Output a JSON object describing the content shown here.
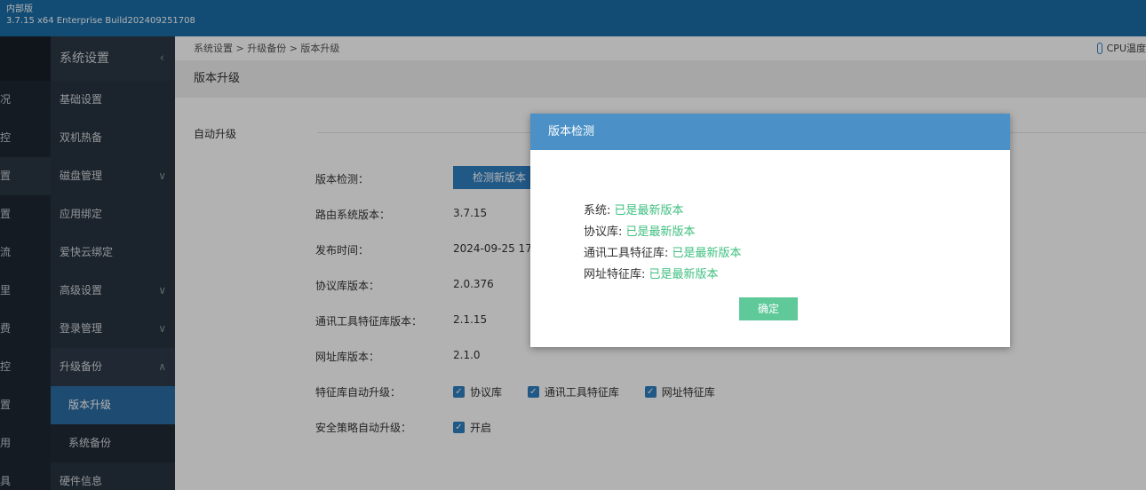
{
  "window": {
    "title_line1": "内部版",
    "title_line2": "3.7.15 x64 Enterprise Build202409251708"
  },
  "farleft": {
    "items": [
      "况",
      "控",
      "置",
      "置",
      "流",
      "里",
      "费",
      "控",
      "置",
      "用",
      "具"
    ]
  },
  "sidebar": {
    "title": "系统设置",
    "items": [
      {
        "label": "基础设置"
      },
      {
        "label": "双机热备"
      },
      {
        "label": "磁盘管理"
      },
      {
        "label": "应用绑定"
      },
      {
        "label": "爱快云绑定"
      },
      {
        "label": "高级设置"
      },
      {
        "label": "登录管理"
      },
      {
        "label": "升级备份"
      },
      {
        "label": "版本升级"
      },
      {
        "label": "系统备份"
      },
      {
        "label": "硬件信息"
      }
    ]
  },
  "breadcrumb": {
    "text": "系统设置 > 升级备份 > 版本升级"
  },
  "status": {
    "cpu_label": "CPU温度"
  },
  "page": {
    "title": "版本升级",
    "section": "自动升级"
  },
  "form": {
    "check_label": "版本检测：",
    "check_button": "检测新版本",
    "rows": [
      {
        "label": "路由系统版本：",
        "value": "3.7.15"
      },
      {
        "label": "发布时间：",
        "value": "2024-09-25 17:08"
      },
      {
        "label": "协议库版本：",
        "value": "2.0.376"
      },
      {
        "label": "通讯工具特征库版本：",
        "value": "2.1.15"
      },
      {
        "label": "网址库版本：",
        "value": "2.1.0"
      }
    ],
    "auto_upgrade_label": "特征库自动升级：",
    "auto_upgrade_options": [
      "协议库",
      "通讯工具特征库",
      "网址特征库"
    ],
    "security_label": "安全策略自动升级：",
    "security_option": "开启"
  },
  "modal": {
    "title": "版本检测",
    "lines": [
      {
        "label": "系统:",
        "status": "已是最新版本"
      },
      {
        "label": "协议库:",
        "status": "已是最新版本"
      },
      {
        "label": "通讯工具特征库:",
        "status": "已是最新版本"
      },
      {
        "label": "网址特征库:",
        "status": "已是最新版本"
      }
    ],
    "confirm": "确定"
  },
  "colors": {
    "topbar": "#1a6ea8",
    "sidebar": "#27333f",
    "active": "#2c6ca3",
    "modal_header": "#4b91c7",
    "ok_text": "#3fbf7f",
    "confirm_button": "#5fc99a"
  }
}
